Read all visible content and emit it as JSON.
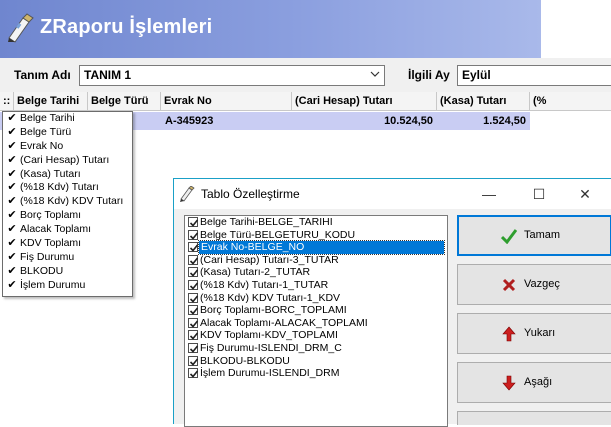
{
  "header": {
    "title": "ZRaporu İşlemleri",
    "icon": "report-pencil-icon"
  },
  "filters": {
    "tanim_label": "Tanım Adı",
    "tanim_value": "TANIM 1",
    "ay_label": "İlgili Ay",
    "ay_value": "Eylül"
  },
  "grid": {
    "row_selector_header": "::",
    "columns": [
      "Belge Tarihi",
      "Belge Türü",
      "Evrak No",
      "(Cari Hesap) Tutarı",
      "(Kasa) Tutarı",
      "(%"
    ],
    "row": {
      "evrak_no": "A-345923",
      "cari_tutar": "10.524,50",
      "kasa_tutar": "1.524,50"
    }
  },
  "column_menu": {
    "items": [
      "Belge Tarihi",
      "Belge Türü",
      "Evrak No",
      "(Cari Hesap) Tutarı",
      "(Kasa) Tutarı",
      "(%18 Kdv) Tutarı",
      "(%18 Kdv) KDV Tutarı",
      "Borç Toplamı",
      "Alacak Toplamı",
      "KDV Toplamı",
      "Fiş Durumu",
      "BLKODU",
      "İşlem Durumu"
    ],
    "check_glyph": "✔"
  },
  "dialog": {
    "title": "Tablo Özelleştirme",
    "fields": [
      "Belge Tarihi-BELGE_TARIHI",
      "Belge Türü-BELGETURU_KODU",
      "Evrak No-BELGE_NO",
      "(Cari Hesap) Tutarı-3_TUTAR",
      "(Kasa) Tutarı-2_TUTAR",
      "(%18 Kdv) Tutarı-1_TUTAR",
      "(%18 Kdv) KDV Tutarı-1_KDV",
      "Borç Toplamı-BORC_TOPLAMI",
      "Alacak Toplamı-ALACAK_TOPLAMI",
      "KDV Toplamı-KDV_TOPLAMI",
      "Fiş Durumu-ISLENDI_DRM_C",
      "BLKODU-BLKODU",
      "İşlem Durumu-ISLENDI_DRM"
    ],
    "selected_index": 2,
    "buttons": {
      "ok": "Tamam",
      "cancel": "Vazgeç",
      "up": "Yukarı",
      "down": "Aşağı"
    },
    "window_controls": {
      "minimize": "—",
      "maximize": "☐",
      "close": "✕"
    }
  },
  "colors": {
    "header_gradient_start": "#6f86cf",
    "selected_row": "#c9cdf3",
    "dialog_accent": "#1aa0c7",
    "selection_blue": "#0078d7"
  }
}
